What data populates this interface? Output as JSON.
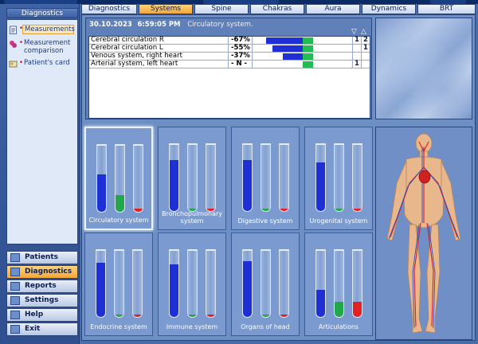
{
  "sidebar": {
    "title": "Diagnostics",
    "sub_items": [
      {
        "label": "Measurements",
        "icon": "clipboard-icon",
        "active": true
      },
      {
        "label": "Measurement comparison",
        "icon": "compare-icon",
        "active": false
      },
      {
        "label": "Patient's card",
        "icon": "card-icon",
        "active": false
      }
    ],
    "nav": [
      {
        "label": "Patients",
        "icon": "patients-icon",
        "active": false
      },
      {
        "label": "Diagnostics",
        "icon": "diagnostics-icon",
        "active": true
      },
      {
        "label": "Reports",
        "icon": "reports-icon",
        "active": false
      },
      {
        "label": "Settings",
        "icon": "settings-icon",
        "active": false
      },
      {
        "label": "Help",
        "icon": "help-icon",
        "active": false
      },
      {
        "label": "Exit",
        "icon": "exit-icon",
        "active": false
      }
    ]
  },
  "tabs": [
    {
      "label": "Diagnostics",
      "active": false
    },
    {
      "label": "Systems",
      "active": true
    },
    {
      "label": "Spine",
      "active": false
    },
    {
      "label": "Chakras",
      "active": false
    },
    {
      "label": "Aura",
      "active": false
    },
    {
      "label": "Dynamics",
      "active": false
    },
    {
      "label": "BRT",
      "active": false
    }
  ],
  "results": {
    "date": "30.10.2023",
    "time": "6:59:05 PM",
    "system": "Circulatory system.",
    "arrow_down": "▽",
    "arrow_up": "△",
    "rows": [
      {
        "name": "Cerebral circulation R",
        "percent": "-67%",
        "value": -67,
        "c1": "1",
        "c2": "2"
      },
      {
        "name": "Cerebral circulation L",
        "percent": "-55%",
        "value": -55,
        "c1": "",
        "c2": "1"
      },
      {
        "name": "Venous system, right heart",
        "percent": "-37%",
        "value": -37,
        "c1": "",
        "c2": ""
      },
      {
        "name": "Arterial system, left heart",
        "percent": "- N -",
        "value": 0,
        "c1": "1",
        "c2": ""
      }
    ]
  },
  "systems": [
    {
      "label": "Circulatory system",
      "active": true,
      "tubes": [
        {
          "level": 0.55,
          "color": "#1f2fd6"
        },
        {
          "level": 0.25,
          "color": "#22a84a"
        },
        {
          "level": 0.05,
          "color": "#e22222"
        }
      ]
    },
    {
      "label": "Bronchopulmonary system",
      "active": false,
      "tubes": [
        {
          "level": 0.75,
          "color": "#1f2fd6"
        },
        {
          "level": 0.04,
          "color": "#22a84a"
        },
        {
          "level": 0.04,
          "color": "#e22222"
        }
      ]
    },
    {
      "label": "Digestive system",
      "active": false,
      "tubes": [
        {
          "level": 0.75,
          "color": "#1f2fd6"
        },
        {
          "level": 0.04,
          "color": "#22a84a"
        },
        {
          "level": 0.04,
          "color": "#e22222"
        }
      ]
    },
    {
      "label": "Urogenital system",
      "active": false,
      "tubes": [
        {
          "level": 0.72,
          "color": "#1f2fd6"
        },
        {
          "level": 0.04,
          "color": "#22a84a"
        },
        {
          "level": 0.04,
          "color": "#e22222"
        }
      ]
    },
    {
      "label": "Endocrine system",
      "active": false,
      "tubes": [
        {
          "level": 0.8,
          "color": "#1f2fd6"
        },
        {
          "level": 0.04,
          "color": "#22a84a"
        },
        {
          "level": 0.04,
          "color": "#e22222"
        }
      ]
    },
    {
      "label": "Immune system",
      "active": false,
      "tubes": [
        {
          "level": 0.78,
          "color": "#1f2fd6"
        },
        {
          "level": 0.04,
          "color": "#22a84a"
        },
        {
          "level": 0.04,
          "color": "#e22222"
        }
      ]
    },
    {
      "label": "Organs of head",
      "active": false,
      "tubes": [
        {
          "level": 0.82,
          "color": "#1f2fd6"
        },
        {
          "level": 0.04,
          "color": "#22a84a"
        },
        {
          "level": 0.04,
          "color": "#e22222"
        }
      ]
    },
    {
      "label": "Articulations",
      "active": false,
      "tubes": [
        {
          "level": 0.4,
          "color": "#1f2fd6"
        },
        {
          "level": 0.22,
          "color": "#22a84a"
        },
        {
          "level": 0.22,
          "color": "#e22222"
        }
      ]
    }
  ],
  "colors": {
    "bar_blue": "#1f2fd6",
    "bar_green": "#22bb55",
    "active_tab": "#f3a63a"
  }
}
